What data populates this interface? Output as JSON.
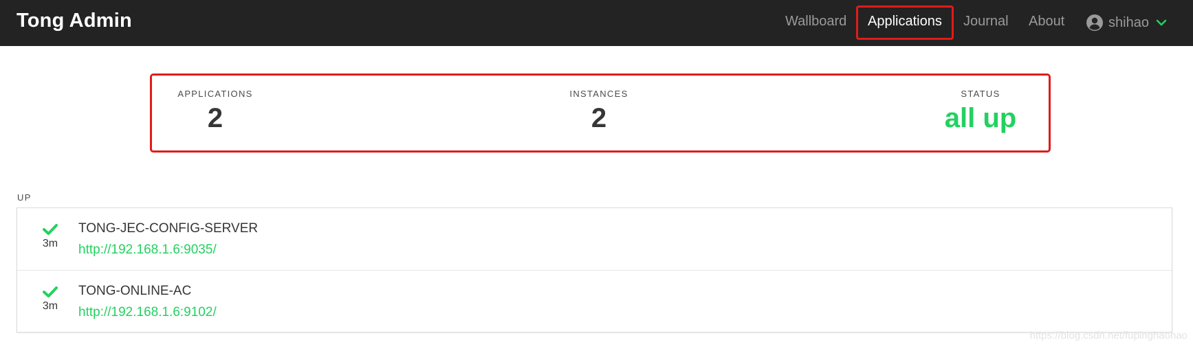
{
  "brand": "Tong Admin",
  "nav": {
    "wallboard": "Wallboard",
    "applications": "Applications",
    "journal": "Journal",
    "about": "About",
    "user": "shihao"
  },
  "stats": {
    "applications_label": "APPLICATIONS",
    "applications_value": "2",
    "instances_label": "INSTANCES",
    "instances_value": "2",
    "status_label": "STATUS",
    "status_value": "all up"
  },
  "section": "UP",
  "apps": [
    {
      "name": "TONG-JEC-CONFIG-SERVER",
      "url": "http://192.168.1.6:9035/",
      "uptime": "3m",
      "status_icon": "check-icon"
    },
    {
      "name": "TONG-ONLINE-AC",
      "url": "http://192.168.1.6:9102/",
      "uptime": "3m",
      "status_icon": "check-icon"
    }
  ],
  "watermark": "https://blog.csdn.net/fupinghaohao",
  "colors": {
    "navbar": "#232323",
    "accent": "#23d160",
    "highlight": "#e01b1b"
  }
}
